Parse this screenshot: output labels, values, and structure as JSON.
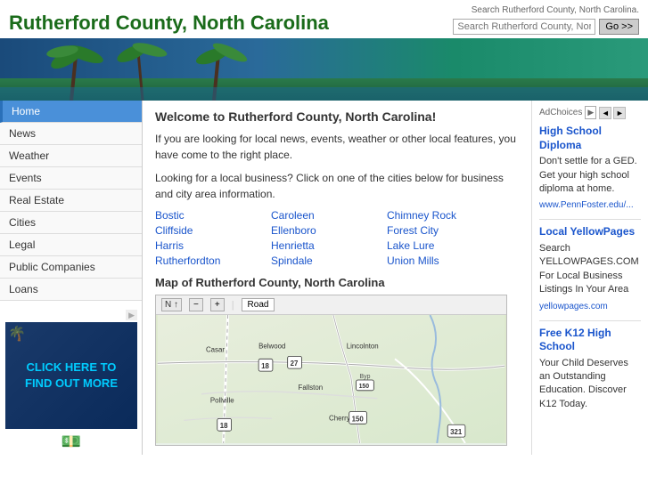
{
  "header": {
    "title": "Rutherford County, North Carolina",
    "search_placeholder": "Search Rutherford County, North Carolina...",
    "search_label": "Search Rutherford County, North Carolina.",
    "search_button": "Go >>"
  },
  "sidebar": {
    "items": [
      {
        "label": "Home",
        "active": true
      },
      {
        "label": "News",
        "active": false
      },
      {
        "label": "Weather",
        "active": false
      },
      {
        "label": "Events",
        "active": false
      },
      {
        "label": "Real Estate",
        "active": false
      },
      {
        "label": "Cities",
        "active": false
      },
      {
        "label": "Legal",
        "active": false
      },
      {
        "label": "Public Companies",
        "active": false
      },
      {
        "label": "Loans",
        "active": false
      }
    ]
  },
  "content": {
    "heading": "Welcome to Rutherford County, North Carolina!",
    "intro": "If you are looking for local news, events, weather or other local features, you have come to the right place.",
    "business_text": "Looking for a local business? Click on one of the cities below for business and city area information.",
    "cities": {
      "col1": [
        "Bostic",
        "Cliffside",
        "Harris",
        "Rutherfordton"
      ],
      "col2": [
        "Caroleen",
        "Ellenboro",
        "Henrietta",
        "Spindale"
      ],
      "col3": [
        "Chimney Rock",
        "Forest City",
        "Lake Lure",
        "Union Mills"
      ]
    },
    "map_heading": "Map of Rutherford County, North Carolina",
    "map_toolbar": {
      "road_label": "Road"
    }
  },
  "ads": {
    "ad_choices_label": "AdChoices",
    "nav_prev": "◄",
    "nav_next": "►",
    "ad1": {
      "title": "High School Diploma",
      "body": "Don't settle for a GED. Get your high school diploma at home.",
      "link": "www.PennFoster.edu/..."
    },
    "ad2": {
      "title": "Local YellowPages",
      "body": "Search YELLOWPAGES.COM For Local Business Listings In Your Area",
      "link": "yellowpages.com"
    },
    "ad3": {
      "title": "Free K12 High School",
      "body": "Your Child Deserves an Outstanding Education. Discover K12 Today."
    }
  },
  "left_ad": {
    "click_text": "CLICK HERE TO FIND OUT MORE",
    "money_icon": "$"
  }
}
